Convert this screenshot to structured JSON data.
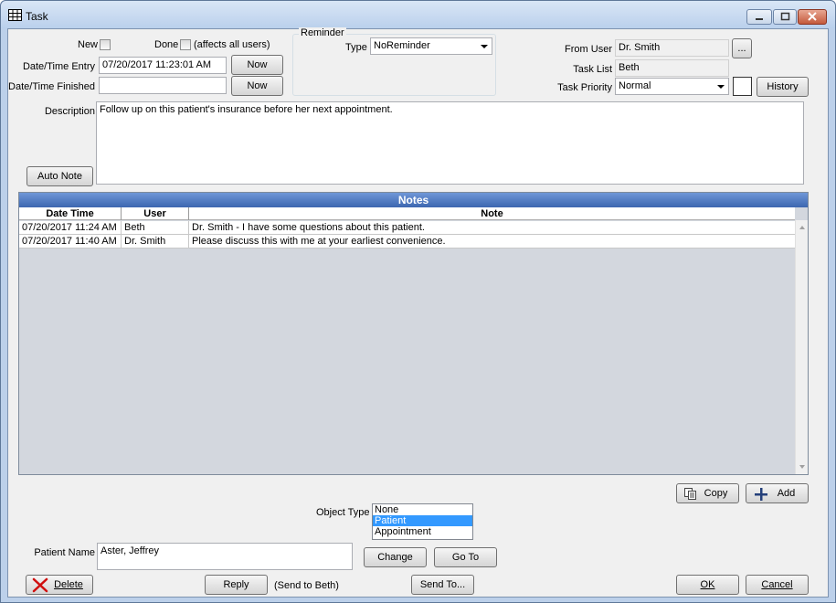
{
  "window": {
    "title": "Task"
  },
  "entry": {
    "new_label": "New",
    "done_label": "Done",
    "done_note": "(affects all users)",
    "entry_label": "Date/Time Entry",
    "entry_value": "07/20/2017 11:23:01 AM",
    "finished_label": "Date/Time Finished",
    "finished_value": "",
    "now_label": "Now"
  },
  "reminder": {
    "group_label": "Reminder",
    "type_label": "Type",
    "type_value": "NoReminder"
  },
  "user": {
    "from_label": "From User",
    "from_value": "Dr. Smith",
    "browse_label": "...",
    "list_label": "Task List",
    "list_value": "Beth",
    "priority_label": "Task Priority",
    "priority_value": "Normal",
    "history_label": "History"
  },
  "description": {
    "label": "Description",
    "text": "Follow up on this patient's insurance before her next appointment.",
    "auto_note_label": "Auto Note"
  },
  "notes": {
    "title": "Notes",
    "columns": [
      "Date Time",
      "User",
      "Note"
    ],
    "rows": [
      {
        "datetime": "07/20/2017 11:24 AM",
        "user": "Beth",
        "note": "Dr. Smith - I have some questions about this patient."
      },
      {
        "datetime": "07/20/2017 11:40 AM",
        "user": "Dr. Smith",
        "note": "Please discuss this with me at your earliest convenience."
      }
    ]
  },
  "note_actions": {
    "copy_label": "Copy",
    "add_label": "Add"
  },
  "object": {
    "label": "Object Type",
    "options": [
      "None",
      "Patient",
      "Appointment"
    ],
    "selected": "Patient"
  },
  "patient": {
    "label": "Patient Name",
    "value": "Aster, Jeffrey",
    "change_label": "Change",
    "goto_label": "Go To"
  },
  "footer": {
    "delete_label": "Delete",
    "reply_label": "Reply",
    "reply_note": "(Send to Beth)",
    "send_to_label": "Send To...",
    "ok_label": "OK",
    "cancel_label": "Cancel"
  }
}
